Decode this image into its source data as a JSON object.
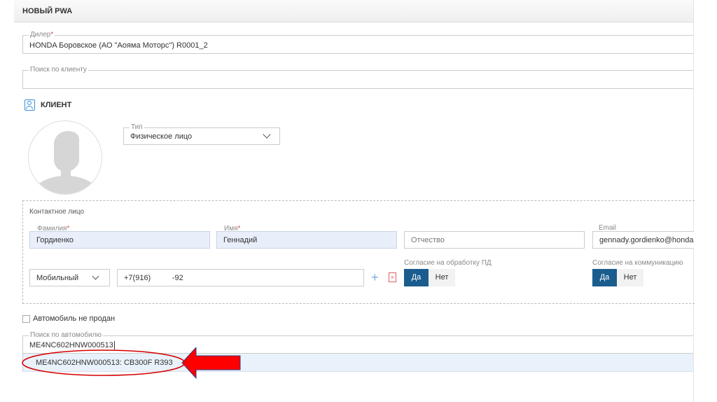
{
  "header": {
    "title": "НОВЫЙ PWA"
  },
  "dealer": {
    "label": "Дилер",
    "required": "*",
    "value": "HONDA Боровское (АО \"Аояма Моторс\") R0001_2"
  },
  "client_search": {
    "label": "Поиск по клиенту",
    "value": ""
  },
  "client": {
    "section_title": "КЛИЕНТ",
    "type_label": "Тип",
    "type_value": "Физическое лицо"
  },
  "contact": {
    "title": "Контактное лицо",
    "last_name": {
      "label": "Фамилия",
      "required": "*",
      "value": "Гордиенко"
    },
    "first_name": {
      "label": "Имя",
      "required": "*",
      "value": "Геннадий"
    },
    "middle_name": {
      "placeholder": "Отчество"
    },
    "email": {
      "label": "Email",
      "value": "gennady.gordienko@honda"
    },
    "phone_type": "Мобильный",
    "phone": "+7(916)          -92",
    "consent_pd": {
      "label": "Согласие на обработку ПД",
      "yes": "Да",
      "no": "Нет",
      "selected": "Да"
    },
    "consent_comm": {
      "label": "Согласие на коммуникацию",
      "yes": "Да",
      "no": "Нет",
      "selected": "Да"
    }
  },
  "car": {
    "not_sold_label": "Автомобиль не продан",
    "search_label": "Поиск по автомобилю",
    "search_value": "ME4NC602HNW000513",
    "suggestion": "ME4NC602HNW000513: CB300F R393"
  },
  "colors": {
    "accent": "#1b5c8f",
    "annotation": "#e00000"
  }
}
